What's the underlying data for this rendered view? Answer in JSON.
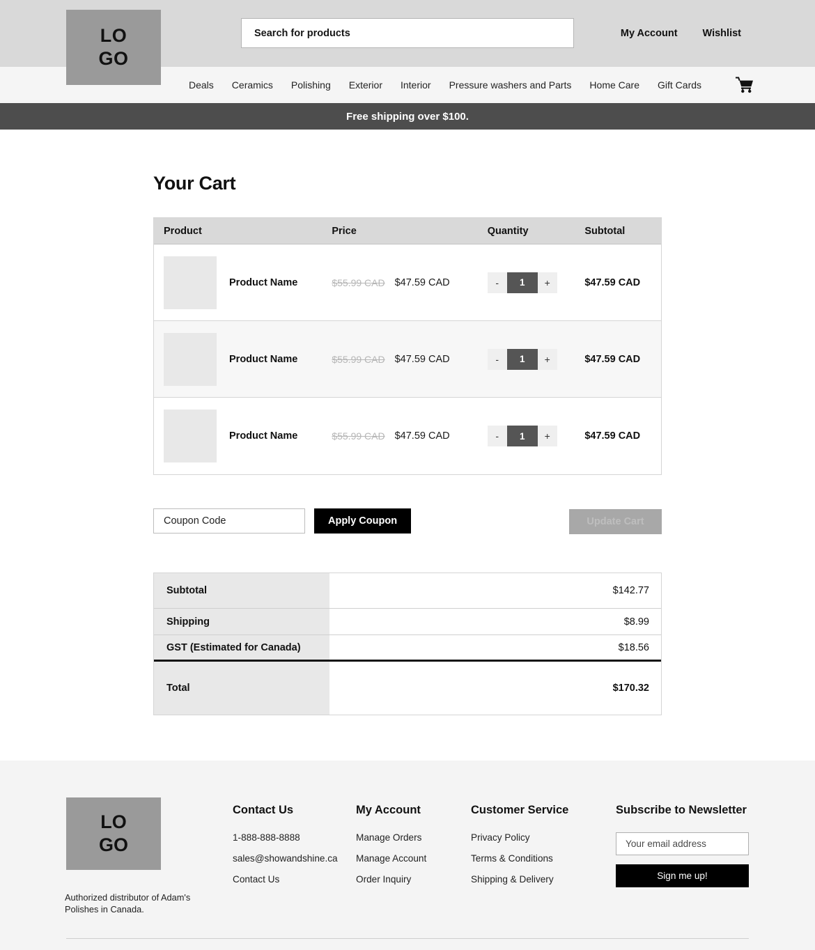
{
  "header": {
    "logo_line1": "LO",
    "logo_line2": "GO",
    "search_placeholder": "Search for products",
    "search_value": "",
    "my_account": "My Account",
    "wishlist": "Wishlist",
    "cart_icon": "shopping-cart-icon"
  },
  "nav": {
    "items": [
      "Deals",
      "Ceramics",
      "Polishing",
      "Exterior",
      "Interior",
      "Pressure washers and Parts",
      "Home Care",
      "Gift Cards"
    ]
  },
  "promo": {
    "text": "Free shipping over $100."
  },
  "cart": {
    "title": "Your Cart",
    "columns": {
      "product": "Product",
      "price": "Price",
      "quantity": "Quantity",
      "subtotal": "Subtotal"
    },
    "rows": [
      {
        "name": "Product Name",
        "price_old": "$55.99 CAD",
        "price_new": "$47.59 CAD",
        "qty": "1",
        "minus": "-",
        "plus": "+",
        "subtotal": "$47.59 CAD"
      },
      {
        "name": "Product Name",
        "price_old": "$55.99 CAD",
        "price_new": "$47.59 CAD",
        "qty": "1",
        "minus": "-",
        "plus": "+",
        "subtotal": "$47.59 CAD"
      },
      {
        "name": "Product Name",
        "price_old": "$55.99 CAD",
        "price_new": "$47.59 CAD",
        "qty": "1",
        "minus": "-",
        "plus": "+",
        "subtotal": "$47.59 CAD"
      }
    ],
    "coupon_placeholder": "Coupon Code",
    "coupon_value": "",
    "apply_coupon": "Apply Coupon",
    "update_cart": "Update Cart"
  },
  "totals": {
    "subtotal_label": "Subtotal",
    "subtotal_value": "$142.77",
    "shipping_label": "Shipping",
    "shipping_value": "$8.99",
    "gst_label": "GST (Estimated for Canada)",
    "gst_value": "$18.56",
    "total_label": "Total",
    "total_value": "$170.32"
  },
  "footer": {
    "logo_line1": "LO",
    "logo_line2": "GO",
    "tagline": "Authorized distributor of Adam's Polishes in Canada.",
    "contact": {
      "heading": "Contact Us",
      "items": [
        "1-888-888-8888",
        "sales@showandshine.ca",
        "Contact Us"
      ]
    },
    "account": {
      "heading": "My Account",
      "items": [
        "Manage Orders",
        "Manage Account",
        "Order Inquiry"
      ]
    },
    "service": {
      "heading": "Customer Service",
      "items": [
        "Privacy Policy",
        "Terms & Conditions",
        "Shipping & Delivery"
      ]
    },
    "newsletter": {
      "heading": "Subscribe to Newsletter",
      "email_placeholder": "Your email address",
      "email_value": "",
      "button": "Sign me up!"
    }
  },
  "colors": {
    "header_bg": "#d9d9d9",
    "nav_bg": "#f5f5f5",
    "promo_bg": "#4d4d4d",
    "accent_black": "#000000",
    "logo_gray": "#9a9a9a",
    "disabled_gray": "#a8a8a8"
  }
}
